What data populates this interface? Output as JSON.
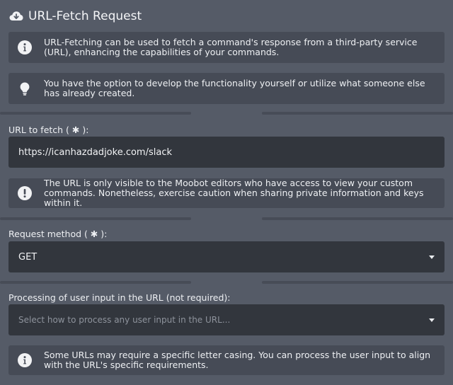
{
  "header": {
    "title": "URL-Fetch Request",
    "icon": "cloud-download-icon"
  },
  "intro": {
    "info_text": "URL-Fetching can be used to fetch a command's response from a third-party service (URL), enhancing the capabilities of your commands.",
    "tip_text": "You have the option to develop the functionality yourself or utilize what someone else has already created."
  },
  "url_field": {
    "label": "URL to fetch ( ✱ ):",
    "value": "https://icanhazdadjoke.com/slack",
    "warning_text": "The URL is only visible to the Moobot editors who have access to view your custom commands. Nonetheless, exercise caution when sharing private information and keys within it."
  },
  "method_field": {
    "label": "Request method ( ✱ ):",
    "value": "GET"
  },
  "processing_field": {
    "label": "Processing of user input in the URL (not required):",
    "placeholder": "Select how to process any user input in the URL...",
    "info_text": "Some URLs may require a specific letter casing. You can process the user input to align with the URL's specific requirements."
  },
  "colors": {
    "background": "#555b67",
    "panel": "#464b56",
    "input": "#32363d",
    "text": "#f2f3f5",
    "placeholder": "#8e939c"
  }
}
